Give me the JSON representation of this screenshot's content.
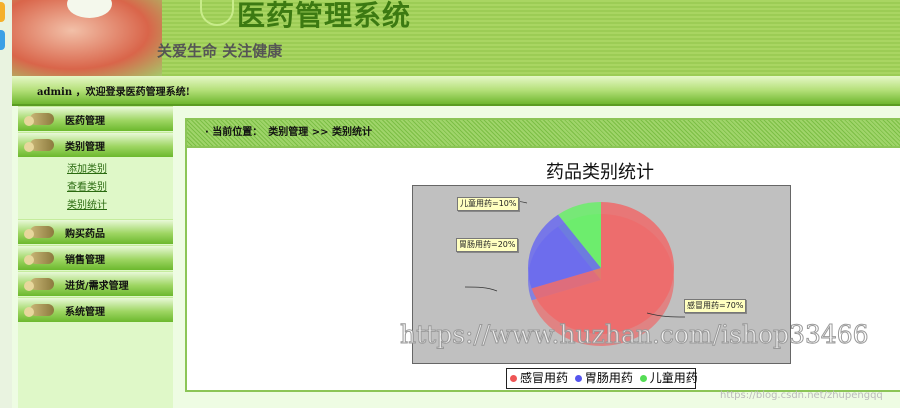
{
  "header": {
    "title": "医药管理系统",
    "slogan": "关爱生命  关注健康",
    "welcome": "admin ，欢迎登录医药管理系统!"
  },
  "sidebar": {
    "menus": [
      {
        "label": "医药管理"
      },
      {
        "label": "类别管理",
        "subs": [
          "添加类别",
          "查看类别",
          "类别统计"
        ]
      },
      {
        "label": "购买药品"
      },
      {
        "label": "销售管理"
      },
      {
        "label": "进货/需求管理"
      },
      {
        "label": "系统管理"
      }
    ]
  },
  "breadcrumb": {
    "prefix": "· 当前位置：",
    "path": "类别管理 >> 类别统计"
  },
  "chart_data": {
    "type": "pie",
    "title": "药品类别统计",
    "categories": [
      "感冒用药",
      "胃肠用药",
      "儿童用药"
    ],
    "values": [
      70,
      20,
      10
    ],
    "labels": [
      "感冒用药=70%",
      "胃肠用药=20%",
      "儿童用药=10%"
    ],
    "colors": [
      "#ee6a6a",
      "#6a6aee",
      "#6aee6a"
    ],
    "legend": "bottom"
  },
  "watermark": "https://www.huzhan.com/ishop33466",
  "csdn_watermark": "https://blog.csdn.net/zhupengqq"
}
